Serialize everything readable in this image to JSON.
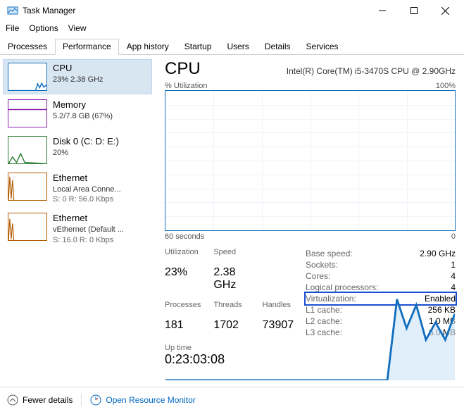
{
  "app_title": "Task Manager",
  "menu": {
    "file": "File",
    "options": "Options",
    "view": "View"
  },
  "tabs": [
    "Processes",
    "Performance",
    "App history",
    "Startup",
    "Users",
    "Details",
    "Services"
  ],
  "active_tab": "Performance",
  "sidebar": [
    {
      "title": "CPU",
      "sub1": "23%  2.38 GHz",
      "sub2": ""
    },
    {
      "title": "Memory",
      "sub1": "5.2/7.8 GB (67%)",
      "sub2": ""
    },
    {
      "title": "Disk 0 (C: D: E:)",
      "sub1": "20%",
      "sub2": ""
    },
    {
      "title": "Ethernet",
      "sub1": "Local Area Conne...",
      "sub2": "S: 0 R: 56.0 Kbps"
    },
    {
      "title": "Ethernet",
      "sub1": "vEthernet (Default ...",
      "sub2": "S: 16.0 R: 0 Kbps"
    }
  ],
  "main": {
    "heading": "CPU",
    "model": "Intel(R) Core(TM) i5-3470S CPU @ 2.90GHz",
    "axis_top_left": "% Utilization",
    "axis_top_right": "100%",
    "axis_bot_left": "60 seconds",
    "axis_bot_right": "0"
  },
  "chart_data": {
    "type": "line",
    "xlabel": "60 seconds",
    "ylabel": "% Utilization",
    "ylim": [
      0,
      100
    ],
    "x_seconds_ago": [
      60,
      58,
      56,
      54,
      52,
      50,
      48,
      46,
      44,
      42,
      40,
      38,
      36,
      34,
      32,
      30,
      28,
      26,
      24,
      22,
      20,
      18,
      16,
      14,
      12,
      10,
      8,
      6,
      4,
      2,
      0
    ],
    "values": [
      0,
      0,
      0,
      0,
      0,
      0,
      0,
      0,
      0,
      0,
      0,
      0,
      0,
      0,
      0,
      0,
      0,
      0,
      0,
      0,
      0,
      0,
      0,
      0,
      28,
      18,
      26,
      14,
      20,
      14,
      23
    ]
  },
  "stats": {
    "utilization_label": "Utilization",
    "utilization": "23%",
    "speed_label": "Speed",
    "speed": "2.38 GHz",
    "processes_label": "Processes",
    "processes": "181",
    "threads_label": "Threads",
    "threads": "1702",
    "handles_label": "Handles",
    "handles": "73907",
    "uptime_label": "Up time",
    "uptime": "0:23:03:08",
    "right": [
      {
        "label": "Base speed:",
        "value": "2.90 GHz"
      },
      {
        "label": "Sockets:",
        "value": "1"
      },
      {
        "label": "Cores:",
        "value": "4"
      },
      {
        "label": "Logical processors:",
        "value": "4"
      },
      {
        "label": "Virtualization:",
        "value": "Enabled",
        "highlight": true
      },
      {
        "label": "L1 cache:",
        "value": "256 KB"
      },
      {
        "label": "L2 cache:",
        "value": "1.0 MB"
      },
      {
        "label": "L3 cache:",
        "value": "6.0 MB"
      }
    ]
  },
  "footer": {
    "fewer": "Fewer details",
    "open_rm": "Open Resource Monitor"
  }
}
